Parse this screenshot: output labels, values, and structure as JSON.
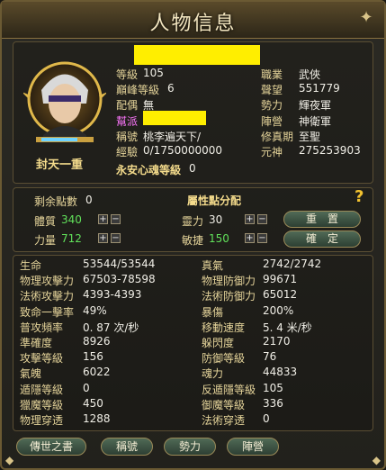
{
  "window": {
    "title": "人物信息"
  },
  "profile": {
    "name_caption": "封天一重",
    "level_label": "等級",
    "level_value": "105",
    "peak_label": "巔峰等級",
    "peak_value": "6",
    "spouse_label": "配偶",
    "spouse_value": "無",
    "guild_label": "幫派",
    "title_label": "稱號",
    "title_value": "桃李遍天下/",
    "exp_label": "經驗",
    "exp_value": "0/1750000000",
    "soul_label": "永安心魂等級",
    "soul_value": "0",
    "job_label": "職業",
    "job_value": "武俠",
    "fame_label": "聲望",
    "fame_value": "551779",
    "force_label": "勢力",
    "force_value": "輝夜軍",
    "camp_label": "陣營",
    "camp_value": "神衛軍",
    "cultivation_label": "修真期",
    "cultivation_value": "至聖",
    "spirit_label": "元神",
    "spirit_value": "275253903"
  },
  "attributes": {
    "header": "屬性點分配",
    "remaining_label": "剩余點數",
    "remaining_value": "0",
    "con_label": "體質",
    "con_value": "340",
    "spi_label": "靈力",
    "spi_value": "30",
    "str_label": "力量",
    "str_value": "712",
    "agi_label": "敏捷",
    "agi_value": "150",
    "reset_label": "重　置",
    "confirm_label": "確　定",
    "plus": "+",
    "minus": "−",
    "help": "?"
  },
  "stats_left": [
    {
      "label": "生命",
      "value": "53544/53544"
    },
    {
      "label": "物理攻擊力",
      "value": "67503-78598"
    },
    {
      "label": "法術攻擊力",
      "value": "4393-4393"
    },
    {
      "label": "致命一擊率",
      "value": "49%"
    },
    {
      "label": "普攻頻率",
      "value": "0. 87 次/秒"
    },
    {
      "label": "準確度",
      "value": "8926"
    },
    {
      "label": "攻擊等級",
      "value": "156"
    },
    {
      "label": "氣魄",
      "value": "6022"
    },
    {
      "label": "遁隱等級",
      "value": "0"
    },
    {
      "label": "獵魔等級",
      "value": "450"
    },
    {
      "label": "物理穿透",
      "value": "1288"
    }
  ],
  "stats_right": [
    {
      "label": "真氣",
      "value": "2742/2742"
    },
    {
      "label": "物理防御力",
      "value": "99671"
    },
    {
      "label": "法術防御力",
      "value": "65012"
    },
    {
      "label": "暴傷",
      "value": "200%"
    },
    {
      "label": "移動速度",
      "value": "5. 4 米/秒"
    },
    {
      "label": "躲閃度",
      "value": "2170"
    },
    {
      "label": "防御等級",
      "value": "76"
    },
    {
      "label": "魂力",
      "value": "44833"
    },
    {
      "label": "反遁隱等級",
      "value": "105"
    },
    {
      "label": "御魔等級",
      "value": "336"
    },
    {
      "label": "法術穿透",
      "value": "0"
    }
  ],
  "bottom_tabs": [
    "傳世之書",
    "稱號",
    "勢力",
    "陣營"
  ]
}
